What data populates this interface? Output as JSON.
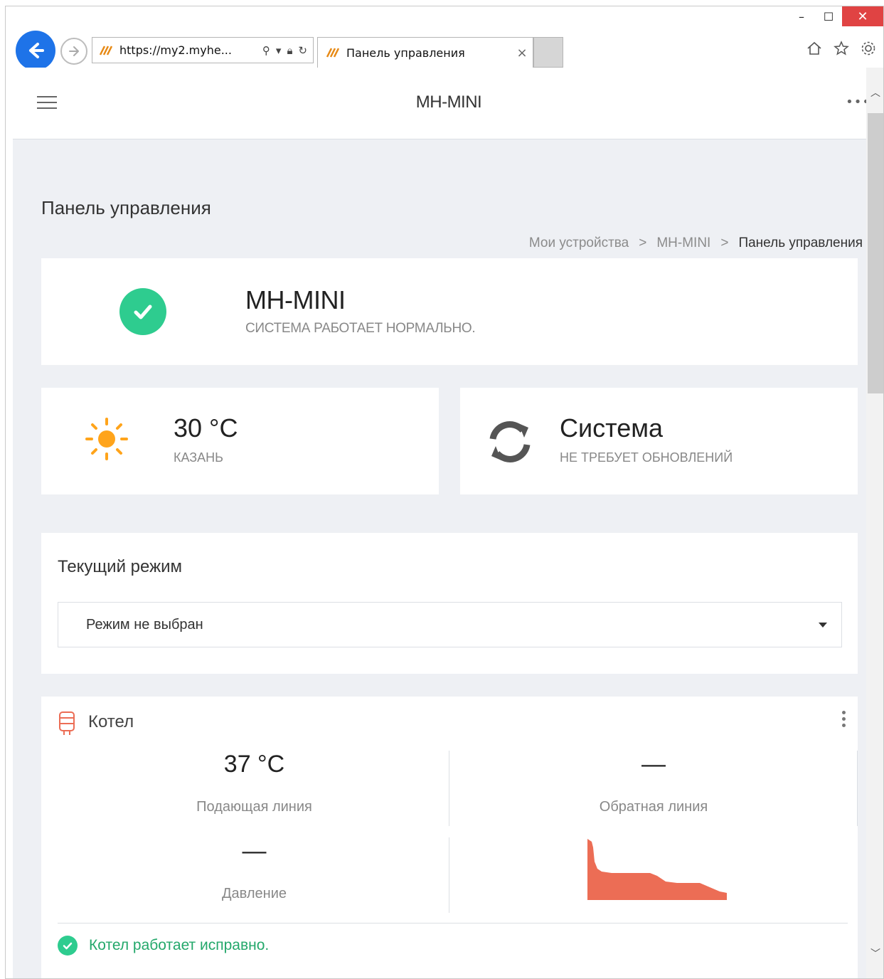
{
  "browser": {
    "url": "https://my2.myhe...",
    "tab_title": "Панель управления",
    "tab_close": "×"
  },
  "appbar": {
    "title": "MH-MINI"
  },
  "page": {
    "title": "Панель управления",
    "breadcrumb": [
      "Мои устройства",
      "MH-MINI",
      "Панель управления"
    ],
    "breadcrumb_sep": ">"
  },
  "status": {
    "name": "MH-MINI",
    "message": "СИСТЕМА РАБОТАЕТ НОРМАЛЬНО."
  },
  "weather": {
    "temperature": "30 °C",
    "city": "КАЗАНЬ"
  },
  "system": {
    "title": "Система",
    "message": "НЕ ТРЕБУЕТ ОБНОВЛЕНИЙ"
  },
  "mode": {
    "label": "Текущий режим",
    "selected": "Режим не выбран"
  },
  "boiler": {
    "title": "Котел",
    "supply_value": "37 °C",
    "supply_label": "Подающая линия",
    "return_value": "—",
    "return_label": "Обратная линия",
    "pressure_value": "—",
    "pressure_label": "Давление",
    "status_message": "Котел работает исправно."
  },
  "colors": {
    "accent": "#1e73e8",
    "success": "#2ecc8f",
    "success_text": "#24a86b",
    "chart_fill": "#ec6d55",
    "sun": "#ffa41b",
    "background": "#eef0f4"
  },
  "icons": {
    "back": "back-arrow-icon",
    "forward": "forward-arrow-icon",
    "home": "home-icon",
    "favorites": "star-icon",
    "settings": "gear-icon",
    "weather": "sun-icon",
    "system": "sync-icon",
    "boiler": "boiler-icon",
    "status": "check-circle-icon"
  }
}
